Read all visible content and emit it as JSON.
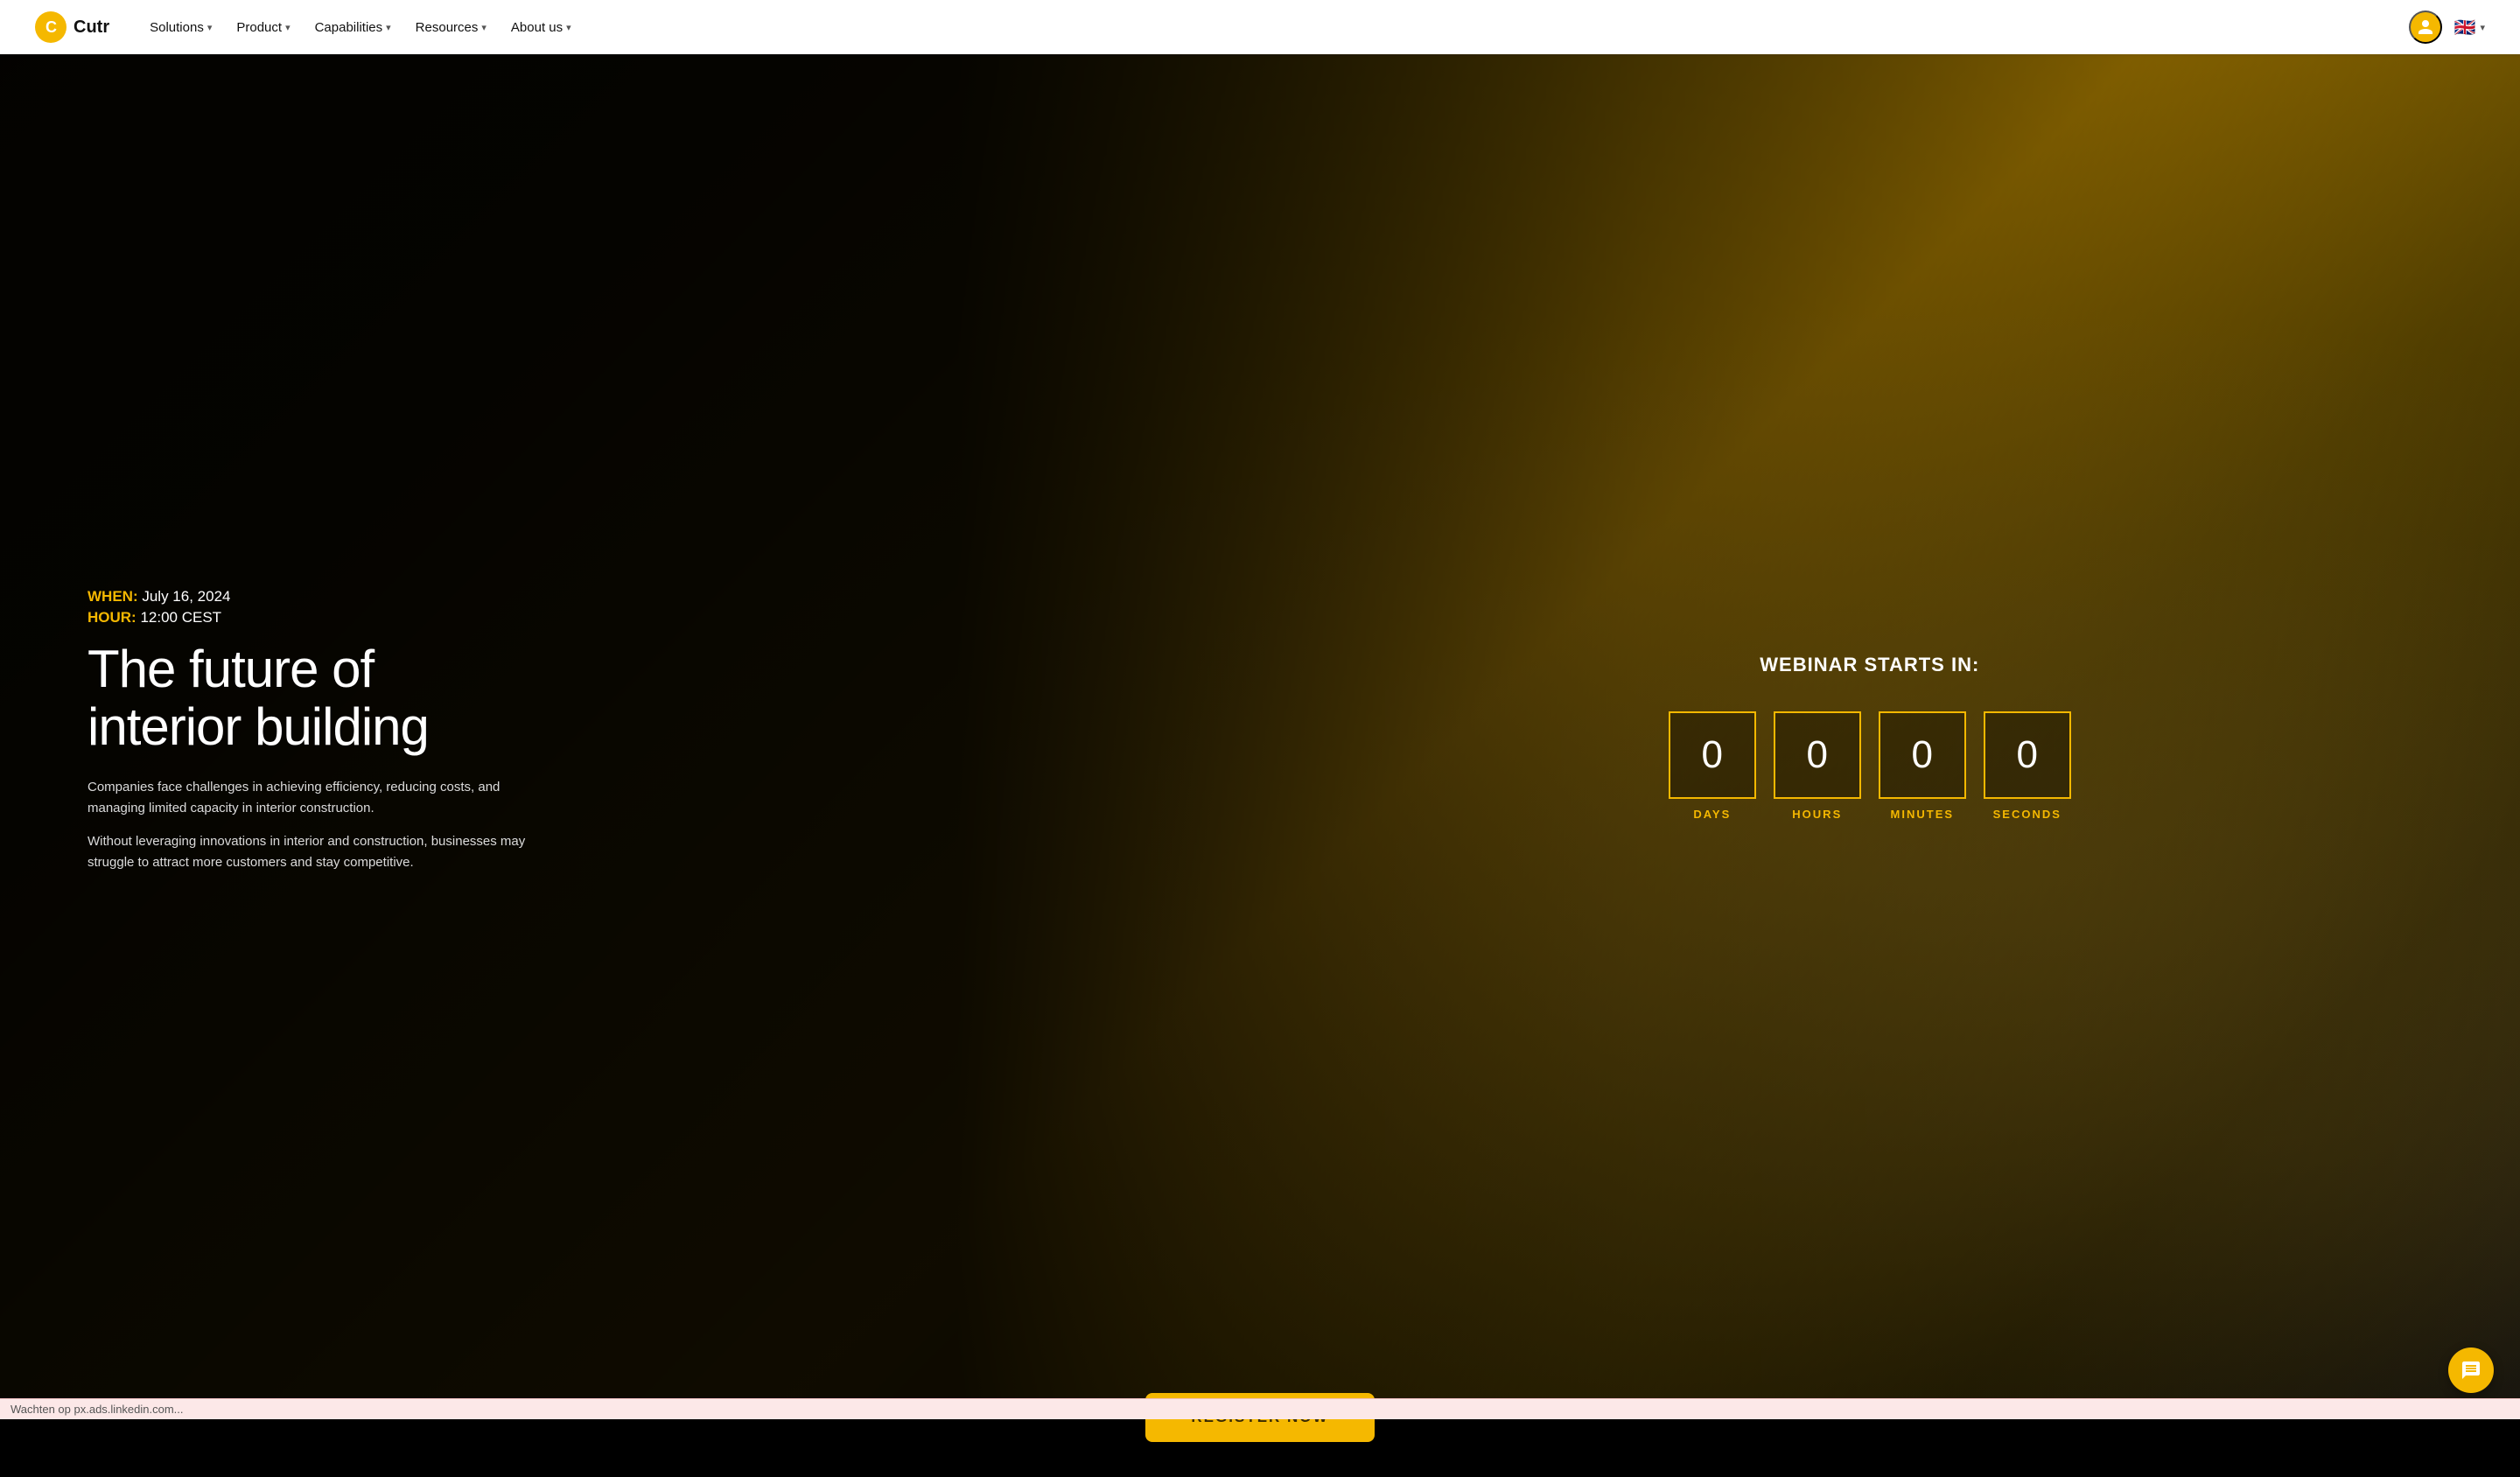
{
  "brand": {
    "logo_letter": "C",
    "name": "Cutr"
  },
  "nav": {
    "links": [
      {
        "id": "solutions",
        "label": "Solutions",
        "has_dropdown": true
      },
      {
        "id": "product",
        "label": "Product",
        "has_dropdown": true
      },
      {
        "id": "capabilities",
        "label": "Capabilities",
        "has_dropdown": true
      },
      {
        "id": "resources",
        "label": "Resources",
        "has_dropdown": true
      },
      {
        "id": "about-us",
        "label": "About us",
        "has_dropdown": true
      }
    ],
    "lang_flag": "🇬🇧",
    "lang_code": "EN"
  },
  "hero": {
    "when_label": "WHEN:",
    "when_value": "July 16, 2024",
    "hour_label": "HOUR:",
    "hour_value": "12:00 CEST",
    "title_line1": "The future of",
    "title_line2": "interior building",
    "desc1": "Companies face challenges in achieving efficiency, reducing costs, and managing limited capacity in interior construction.",
    "desc2": "Without leveraging innovations in interior and construction, businesses may struggle to attract more customers and stay competitive.",
    "webinar_title": "WEBINAR STARTS IN:",
    "countdown": {
      "days": {
        "value": "0",
        "label": "DAYS"
      },
      "hours": {
        "value": "0",
        "label": "HOURS"
      },
      "minutes": {
        "value": "0",
        "label": "MINUTES"
      },
      "seconds": {
        "value": "0",
        "label": "SECONDS"
      }
    },
    "register_btn": "REGISTER NOW"
  },
  "status_bar": {
    "text": "Wachten op px.ads.linkedin.com..."
  }
}
